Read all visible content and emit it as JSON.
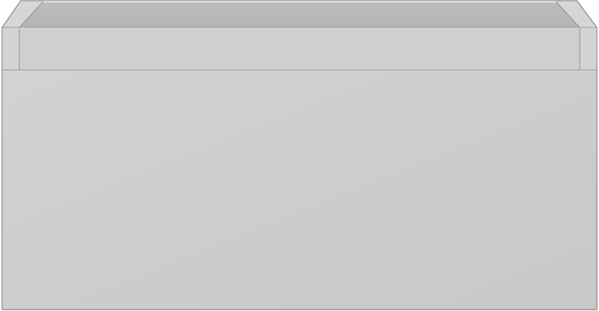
{
  "subject": {
    "kind": "product-render",
    "object": "drawer-unit"
  },
  "colors": {
    "background": "#ffffff",
    "outline": "#8e8e8e",
    "inner_back": "#b9b9b9",
    "inner_floor_shadow": "#aaaaaa",
    "inner_sides": "#c6c6c6",
    "top_rim": "#d4d4d4",
    "rim_inner_panel": "#cfcfcf",
    "front_panel": "#cccccc",
    "front_highlight": "#d3d3d3",
    "edge_line": "#e6e6e6"
  }
}
